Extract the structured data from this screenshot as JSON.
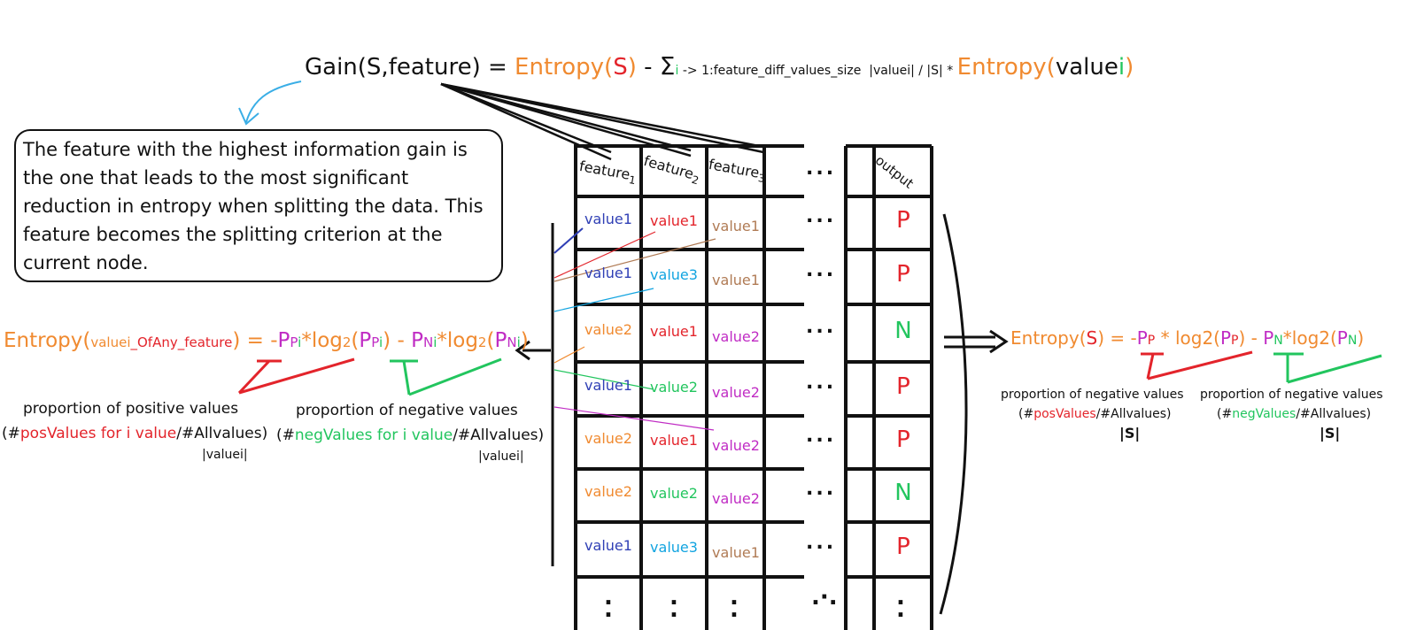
{
  "gain_formula": {
    "gain": "Gain(S,feature) = ",
    "entropy": "Entropy(",
    "s": "S",
    "close": ")",
    "minus": " - ",
    "sigma": "Σ",
    "i": "i",
    "range": " -> 1:feature_diff_values_size",
    "fraction": "|valuei| / |S| * ",
    "entropy2": "Entropy(",
    "value": "value",
    "i2": "i",
    "close2": ")"
  },
  "info_box": {
    "text": "The feature with the highest information gain is the one that leads to the most significant reduction in entropy when splitting the data. This feature becomes the splitting criterion at the current node."
  },
  "table": {
    "headers": [
      "feature1",
      "feature2",
      "feature3",
      "output"
    ],
    "header_parts": [
      {
        "base": "feature",
        "num": "1"
      },
      {
        "base": "feature",
        "num": "2"
      },
      {
        "base": "feature",
        "num": "3"
      }
    ],
    "ellipsis": "...",
    "rows": [
      {
        "f1": "value1",
        "f1c": "blue",
        "f2": "value1",
        "f2c": "red",
        "f3": "value1",
        "f3c": "brown",
        "out": "P"
      },
      {
        "f1": "value1",
        "f1c": "blue",
        "f2": "value3",
        "f2c": "cyan",
        "f3": "value1",
        "f3c": "brown",
        "out": "P"
      },
      {
        "f1": "value2",
        "f1c": "orange",
        "f2": "value1",
        "f2c": "red",
        "f3": "value2",
        "f3c": "magenta",
        "out": "N"
      },
      {
        "f1": "value1",
        "f1c": "blue",
        "f2": "value2",
        "f2c": "green",
        "f3": "value2",
        "f3c": "magenta",
        "out": "P"
      },
      {
        "f1": "value2",
        "f1c": "orange",
        "f2": "value1",
        "f2c": "red",
        "f3": "value2",
        "f3c": "magenta",
        "out": "P"
      },
      {
        "f1": "value2",
        "f1c": "orange",
        "f2": "value2",
        "f2c": "green",
        "f3": "value2",
        "f3c": "magenta",
        "out": "N"
      },
      {
        "f1": "value1",
        "f1c": "blue",
        "f2": "value3",
        "f2c": "cyan",
        "f3": "value1",
        "f3c": "brown",
        "out": "P"
      }
    ]
  },
  "value_entropy": {
    "entropy": "Entropy(",
    "value": "valuei",
    "suffix": "_OfAny_feature",
    "eq": ") = -",
    "p": "P",
    "psub": "P",
    "i": "i",
    "log": "*log",
    "two": "2",
    "open": "(",
    "close": ")",
    "minus": " - ",
    "nsub": "N"
  },
  "value_notes": {
    "pos_label": "proportion of positive values",
    "pos_open": "(#",
    "pos_colored": "posValues for i value",
    "pos_rest": "/#Allvalues)",
    "pos_denom": "|valuei|",
    "neg_label": "proportion of negative values",
    "neg_open": "(#",
    "neg_colored": "negValues for i value",
    "neg_rest": "/#Allvalues)",
    "neg_denom": "|valuei|"
  },
  "s_entropy": {
    "entropy": "Entropy(",
    "s": "S",
    "eq": ") = -",
    "p": "P",
    "psub": "P",
    "mid": " * log2(",
    "close": ")",
    "minus": " - ",
    "nsub": "N",
    "log": "*log2("
  },
  "s_notes": {
    "left_label": "proportion of negative values",
    "left_open": "(#",
    "left_colored": "posValues",
    "left_rest": "/#Allvalues)",
    "left_denom": "|S|",
    "right_label": "proportion of negative values",
    "right_open": "(#",
    "right_colored": "negValues",
    "right_rest": "/#Allvalues)",
    "right_denom": "|S|"
  },
  "colors": {
    "orange": "#f08a30",
    "red": "#e3242b",
    "green": "#22c55e",
    "magenta": "#c02cc4",
    "blue": "#2f3fb5",
    "cyan": "#12a4e0",
    "brown": "#b07b55"
  }
}
